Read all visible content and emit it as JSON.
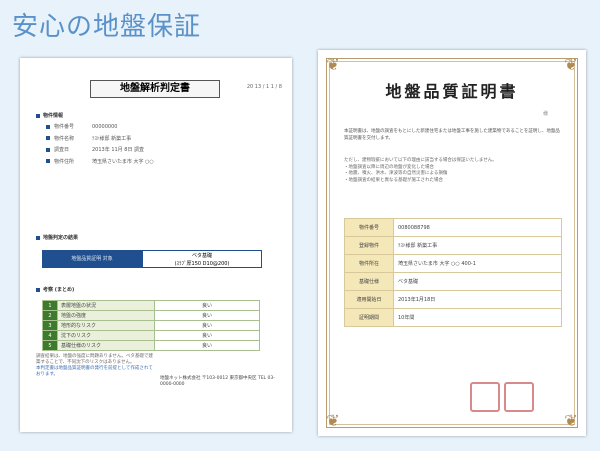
{
  "page_title": "安心の地盤保証",
  "left_doc": {
    "title": "地盤解析判定書",
    "date": "20 13 / 1 1 / 8",
    "section_info": "物件情報",
    "info_rows": [
      {
        "label": "物件番号",
        "value": "00000000"
      },
      {
        "label": "物件名称",
        "value": "ﾃｽﾄ様邸 新築工事"
      },
      {
        "label": "調査日",
        "value": "2013年 11月 8日 調査"
      },
      {
        "label": "物件住所",
        "value": "埼玉県さいたま市 大字 ○○"
      }
    ],
    "section_result": "地盤判定の結果",
    "result_left": "地盤品質証明 対象",
    "result_right": "ベタ基礎",
    "result_right_sub": "(ｽﾗﾌﾞ厚150 D10@200)",
    "section_reason": "考察 (まとめ)",
    "reasons": [
      {
        "num": "1",
        "label": "表層地盤の状況",
        "value": "良い"
      },
      {
        "num": "2",
        "label": "地盤の強度",
        "value": "良い"
      },
      {
        "num": "3",
        "label": "地形的なリスク",
        "value": "良い"
      },
      {
        "num": "4",
        "label": "沈下のリスク",
        "value": "良い"
      },
      {
        "num": "5",
        "label": "基礎仕様のリスク",
        "value": "良い"
      }
    ],
    "paragraph": "調査結果は、地盤の強度に問題ありません。ベタ基礎で建築することで、不同沈下のリスクはありません。",
    "paragraph_blue": "本判定書は地盤品質証明書の発行を前提として作成されております。",
    "company": "地盤ネット株式会社 〒103-0012 東京都中央区 TEL 03-0000-0000"
  },
  "right_doc": {
    "title": "地盤品質証明書",
    "cert_no": "様",
    "paragraph": "本証明書は、地盤の調査をもとにした新建住宅または地盤工事を施した建築物であることを証明し、地盤品質証明書を交付します。",
    "notes": [
      "ただし、建物瑕疵において以下の理由に該当する場合は保証いたしません。",
      "・地盤調査以降に周辺の地盤が変化した場合",
      "・地震、噴火、洪水、津波等の自然災害による損傷",
      "・地盤調査の結果と異なる基礎が施工された場合"
    ],
    "rows": [
      {
        "label": "物件番号",
        "value": "0080088798"
      },
      {
        "label": "登録物件",
        "value": "ﾃｽﾄ様邸 新築工事"
      },
      {
        "label": "物件所在",
        "value": "埼玉県さいたま市 大字 ○○ 400-1"
      },
      {
        "label": "基礎仕様",
        "value": "ベタ基礎"
      },
      {
        "label": "適用開始日",
        "value": "2013年1月18日"
      },
      {
        "label": "証明期間",
        "value": "10年間"
      }
    ]
  }
}
